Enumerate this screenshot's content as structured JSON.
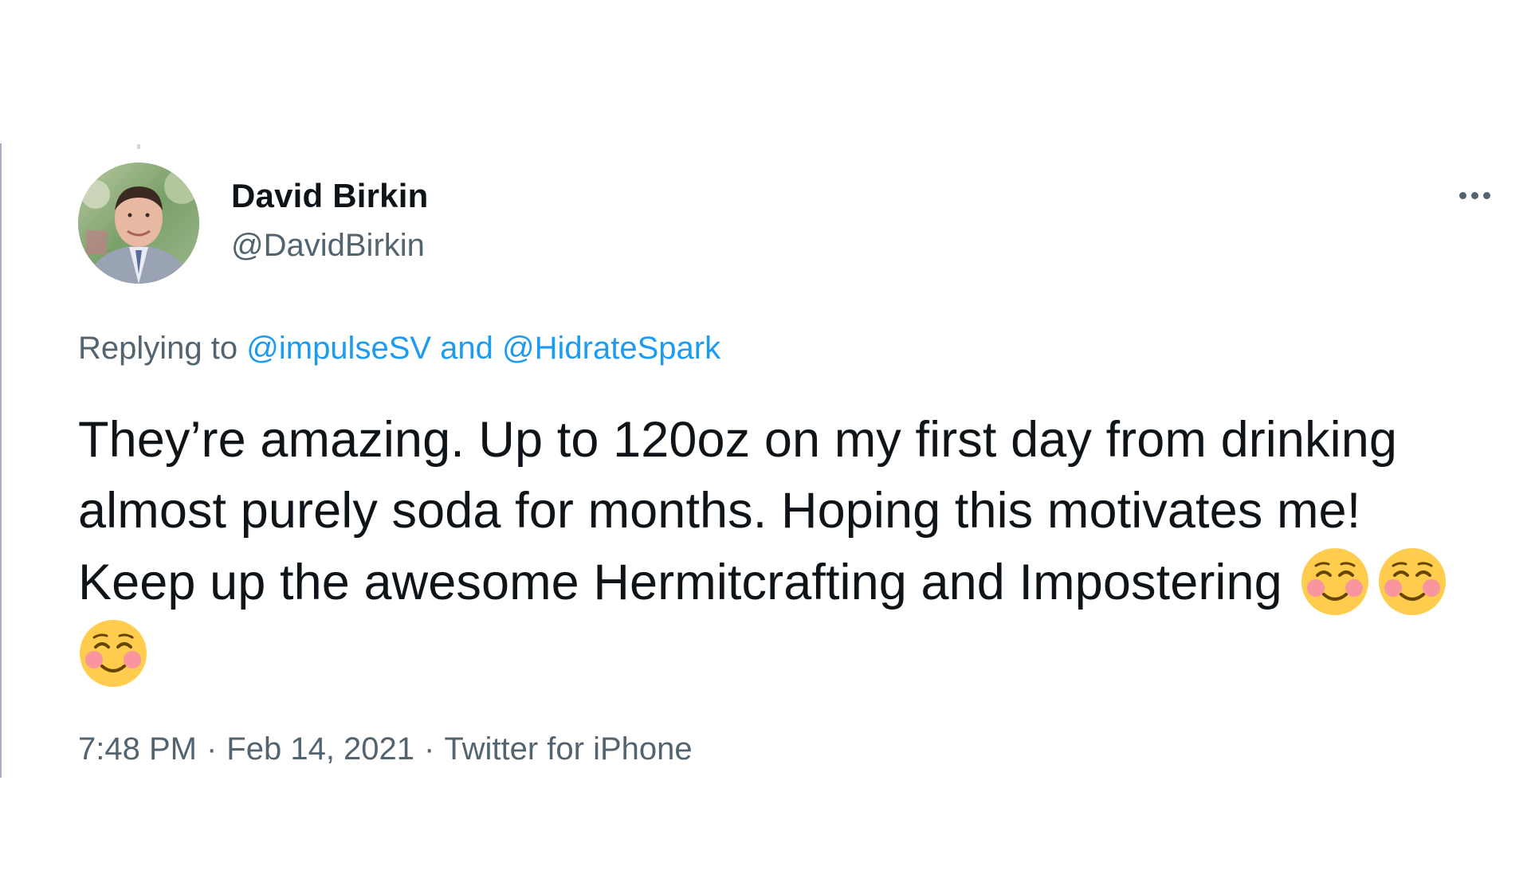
{
  "tweet": {
    "author": {
      "name": "David Birkin",
      "handle": "@DavidBirkin"
    },
    "replying_to": {
      "prefix": "Replying to",
      "mention_1": "@impulseSV",
      "joiner": "and",
      "mention_2": "@HidrateSpark"
    },
    "text": "They’re amazing. Up to 120oz on my first day from drinking almost purely soda for months. Hoping this motivates me! Keep up the awesome Hermitcrafting and Impostering",
    "emojis": [
      "smiling-face-with-smiling-eyes-icon",
      "smiling-face-with-smiling-eyes-icon",
      "smiling-face-with-smiling-eyes-icon"
    ],
    "time": "7:48 PM",
    "separator": "·",
    "date": "Feb 14, 2021",
    "source": "Twitter for iPhone"
  },
  "colors": {
    "text_primary": "#0f1419",
    "text_secondary": "#536471",
    "link": "#1d9bf0",
    "left_rule": "#b3a7cc"
  }
}
